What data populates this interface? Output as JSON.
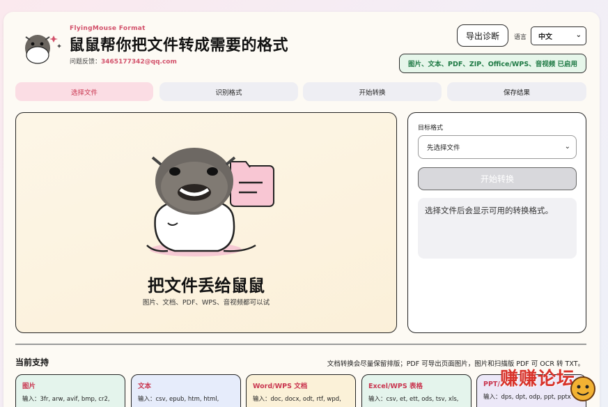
{
  "header": {
    "brand": "FlyingMouse Format",
    "title": "鼠鼠帮你把文件转成需要的格式",
    "feedback_label": "问题反馈：",
    "feedback_email": "3465177342@qq.com",
    "export_label": "导出诊断",
    "language_label": "语言",
    "language_value": "中文",
    "enabled_badge": "图片、文本、PDF、ZIP、Office/WPS、音视频 已启用"
  },
  "steps": [
    {
      "label": "选择文件",
      "active": true
    },
    {
      "label": "识别格式",
      "active": false
    },
    {
      "label": "开始转换",
      "active": false
    },
    {
      "label": "保存结果",
      "active": false
    }
  ],
  "dropzone": {
    "title": "把文件丢给鼠鼠",
    "subtitle": "图片、文档、PDF、WPS、音视频都可以试"
  },
  "panel": {
    "target_label": "目标格式",
    "target_value": "先选择文件",
    "convert_label": "开始转换",
    "hint": "选择文件后会显示可用的转换格式。"
  },
  "support": {
    "title": "当前支持",
    "note": "文档转换会尽量保留排版；PDF 可导出页面图片，图片和扫描版 PDF 可 OCR 转 TXT。",
    "cards": [
      {
        "title": "图片",
        "desc": "输入：3fr, arw, avif, bmp, cr2,",
        "color": "#e4f4ec",
        "title_color": "#c9354f"
      },
      {
        "title": "文本",
        "desc": "输入：csv, epub, htm, html,",
        "color": "#e6ecfb",
        "title_color": "#c9354f"
      },
      {
        "title": "Word/WPS 文档",
        "desc": "输入：doc, docx, odt, rtf, wpd,",
        "color": "#fbf1d8",
        "title_color": "#c9354f"
      },
      {
        "title": "Excel/WPS 表格",
        "desc": "输入：csv, et, ett, ods, tsv, xls,",
        "color": "#e4f4ec",
        "title_color": "#c9354f"
      },
      {
        "title": "PPT/",
        "desc": "输入：dps, dpt, odp, ppt, pptx",
        "color": "#ece8f8",
        "title_color": "#c9354f"
      }
    ]
  },
  "watermark": "赚赚论坛"
}
